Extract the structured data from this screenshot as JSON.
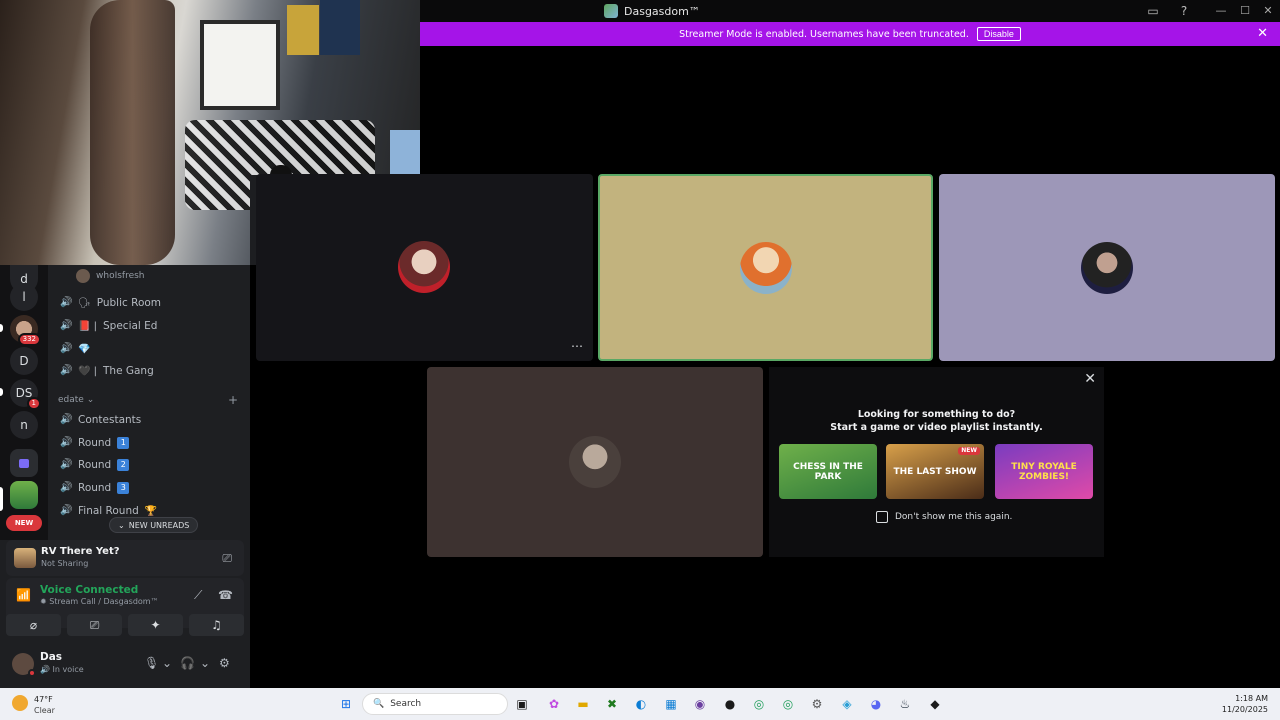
{
  "titlebar": {
    "title": "Dasgasdom™"
  },
  "banner": {
    "message": "Streamer Mode is enabled. Usernames have been truncated.",
    "button": "Disable"
  },
  "servers": [
    {
      "label": "d"
    },
    {
      "label": "l"
    },
    {
      "label": "",
      "badge": "332"
    },
    {
      "label": "D"
    },
    {
      "label": "DS",
      "badge": "1"
    },
    {
      "label": "n"
    },
    {
      "label": ""
    },
    {
      "label": ""
    },
    {
      "label": "NEW"
    }
  ],
  "channels": {
    "voice_user": "whoIsfresh",
    "items": [
      {
        "name": "Public Room",
        "emoji": "🗣"
      },
      {
        "name": "Special Ed",
        "emoji": "📕 |"
      },
      {
        "name": "",
        "emoji": "💎"
      },
      {
        "name": "The Gang",
        "emoji": "🖤 |"
      }
    ],
    "category": "edate",
    "category_items": [
      {
        "name": "Contestants",
        "tag": ""
      },
      {
        "name": "Round",
        "tag": "1"
      },
      {
        "name": "Round",
        "tag": "2"
      },
      {
        "name": "Round",
        "tag": "3"
      },
      {
        "name": "Final Round",
        "tag": "🏆"
      }
    ],
    "new_unreads": "NEW UNREADS"
  },
  "activity": {
    "title": "RV There Yet?",
    "subtitle": "Not Sharing"
  },
  "voice": {
    "status": "Voice Connected",
    "location": "Stream Call / Dasgasdom™"
  },
  "user": {
    "name": "Das",
    "status": "In voice"
  },
  "suggest": {
    "line1": "Looking for something to do?",
    "line2": "Start a game or video playlist instantly.",
    "games": [
      "CHESS IN THE PARK",
      "THE LAST SHOW",
      "TINY ROYALE ZOMBIES!"
    ],
    "new_tag": "NEW",
    "checkbox": "Don't show me this again."
  },
  "taskbar": {
    "weather_temp": "47°F",
    "weather_desc": "Clear",
    "search_placeholder": "Search",
    "time": "1:18 AM",
    "date": "11/20/2025"
  },
  "colors": {
    "banner": "#a514e8",
    "voice_green": "#23a55a",
    "ping_red": "#da373c"
  }
}
